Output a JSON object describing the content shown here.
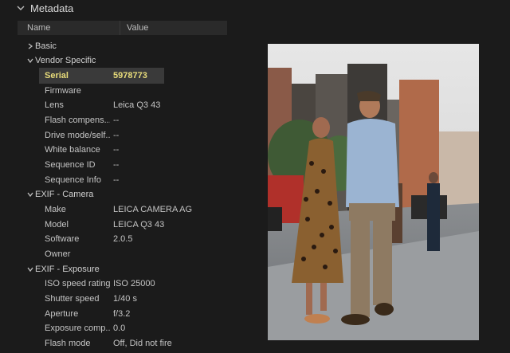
{
  "panel": {
    "title": "Metadata",
    "columns": {
      "name": "Name",
      "value": "Value"
    }
  },
  "groups": {
    "basic": "Basic",
    "vendor": "Vendor Specific",
    "camera": "EXIF - Camera",
    "exposure": "EXIF - Exposure"
  },
  "vendor_items": [
    {
      "key": "Serial",
      "value": "5978773"
    },
    {
      "key": "Firmware",
      "value": ""
    },
    {
      "key": "Lens",
      "value": "Leica Q3 43"
    },
    {
      "key": "Flash compens...",
      "value": "--"
    },
    {
      "key": "Drive mode/self...",
      "value": "--"
    },
    {
      "key": "White balance",
      "value": "--"
    },
    {
      "key": "Sequence ID",
      "value": "--"
    },
    {
      "key": "Sequence Info",
      "value": "--"
    }
  ],
  "camera_items": [
    {
      "key": "Make",
      "value": "LEICA CAMERA AG"
    },
    {
      "key": "Model",
      "value": "LEICA Q3 43"
    },
    {
      "key": "Software",
      "value": "2.0.5"
    },
    {
      "key": "Owner",
      "value": ""
    }
  ],
  "exposure_items": [
    {
      "key": "ISO speed rating",
      "value": "ISO 25000"
    },
    {
      "key": "Shutter speed",
      "value": "1/40 s"
    },
    {
      "key": "Aperture",
      "value": "f/3.2"
    },
    {
      "key": "Exposure comp...",
      "value": "0.0"
    },
    {
      "key": "Flash mode",
      "value": "Off, Did not fire"
    }
  ],
  "colors": {
    "background": "#1b1b1b",
    "selected_text": "#e8dc7a",
    "selected_bg": "#3a3a3a"
  },
  "icons": {
    "collapse": "chevron-down-icon",
    "expand": "chevron-right-icon"
  }
}
